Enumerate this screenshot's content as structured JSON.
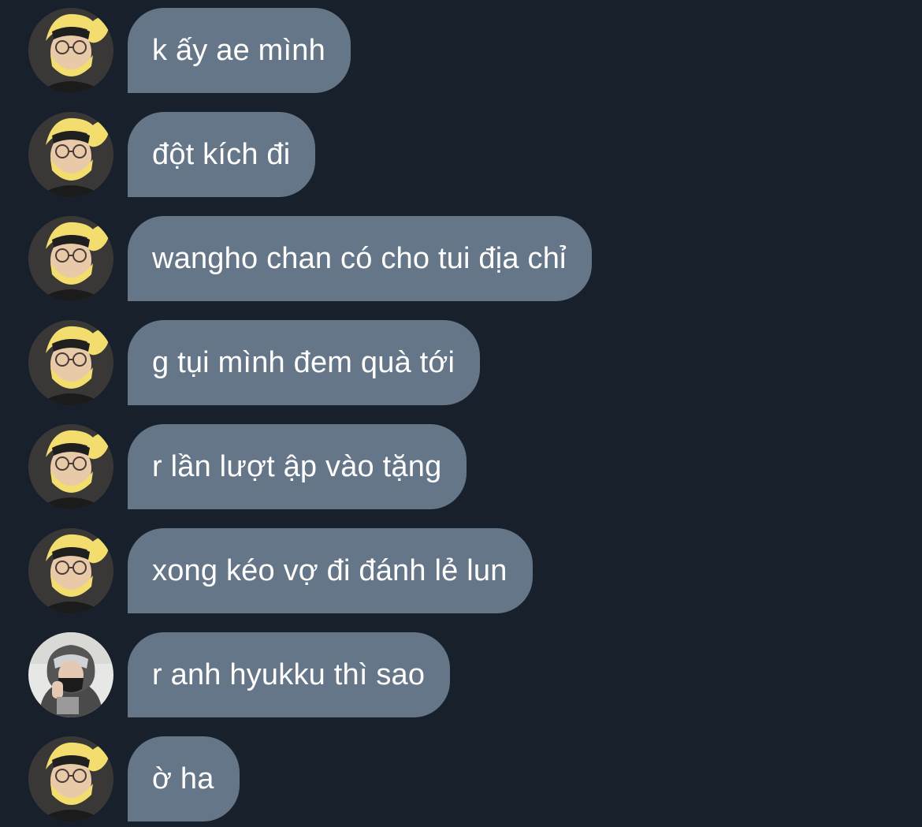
{
  "messages": [
    {
      "text": "k ấy ae mình",
      "avatar": "yellow-hood-avatar"
    },
    {
      "text": "đột kích đi",
      "avatar": "yellow-hood-avatar"
    },
    {
      "text": "wangho chan có cho tui địa chỉ",
      "avatar": "yellow-hood-avatar"
    },
    {
      "text": "g tụi mình đem quà tới",
      "avatar": "yellow-hood-avatar"
    },
    {
      "text": "r lần lượt ập vào tặng",
      "avatar": "yellow-hood-avatar"
    },
    {
      "text": "xong kéo vợ đi đánh lẻ lun",
      "avatar": "yellow-hood-avatar"
    },
    {
      "text": "r anh hyukku thì sao",
      "avatar": "gray-hoodie-avatar"
    },
    {
      "text": "ờ ha",
      "avatar": "yellow-hood-avatar"
    }
  ],
  "colors": {
    "background": "#17202b",
    "bubble": "#667689",
    "text": "#ffffff"
  }
}
